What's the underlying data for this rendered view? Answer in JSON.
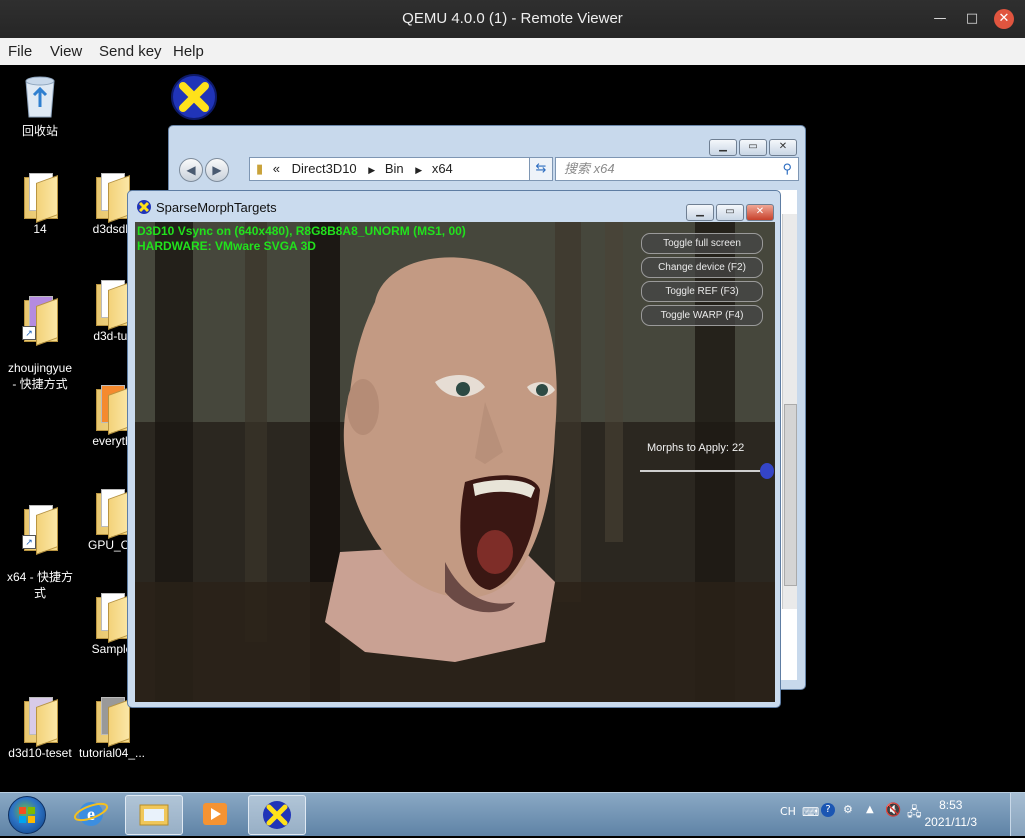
{
  "window": {
    "title": "QEMU 4.0.0 (1) - Remote Viewer"
  },
  "menu": {
    "file": "File",
    "view": "View",
    "sendkey": "Send key",
    "help": "Help"
  },
  "desktop": {
    "recycle_bin": "回收站",
    "dx_partial": "D",
    "icons": [
      {
        "label": "14"
      },
      {
        "label": "d3dsdk"
      },
      {
        "label": "zhoujingyue\n- 快捷方式"
      },
      {
        "label": "d3d-tut"
      },
      {
        "label": "everyth"
      },
      {
        "label": "x64 - 快捷方\n式"
      },
      {
        "label": "GPU_Ca"
      },
      {
        "label": "Sample"
      },
      {
        "label": "d3d10-teset"
      },
      {
        "label": "tutorial04_..."
      }
    ]
  },
  "explorer": {
    "crumb_sep": "«",
    "crumbs": [
      "Direct3D10",
      "Bin",
      "x64"
    ],
    "search_placeholder": "搜索 x64"
  },
  "d3d": {
    "title": "SparseMorphTargets",
    "hud_line1": "D3D10 Vsync on (640x480), R8G8B8A8_UNORM (MS1, 00)",
    "hud_line2": "HARDWARE: VMware SVGA 3D",
    "buttons": [
      "Toggle full screen",
      "Change device (F2)",
      "Toggle REF (F3)",
      "Toggle WARP (F4)"
    ],
    "morphs_label": "Morphs to Apply: 22",
    "morphs_value": 22
  },
  "taskbar": {
    "lang": "CH",
    "time": "8:53",
    "date": "2021/11/3"
  }
}
